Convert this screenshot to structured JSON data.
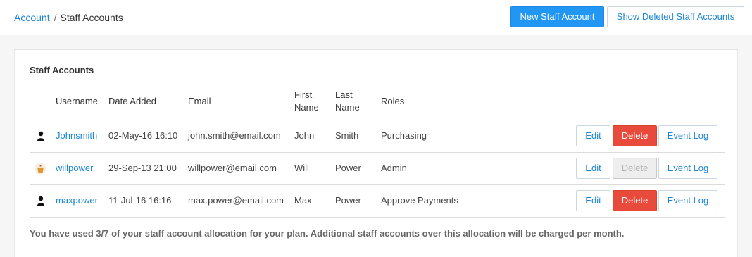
{
  "breadcrumb": {
    "parent": "Account",
    "separator": "/",
    "current": "Staff Accounts"
  },
  "header_actions": {
    "new_label": "New Staff Account",
    "show_deleted_label": "Show Deleted Staff Accounts"
  },
  "panel": {
    "title": "Staff Accounts",
    "columns": {
      "username": "Username",
      "date_added": "Date Added",
      "email": "Email",
      "first_name_1": "First",
      "first_name_2": "Name",
      "last_name_1": "Last",
      "last_name_2": "Name",
      "roles": "Roles"
    },
    "rows": [
      {
        "avatar": "person-silhouette-icon",
        "username": "Johnsmith",
        "date_added": "02-May-16 16:10",
        "email": "john.smith@email.com",
        "first_name": "John",
        "last_name": "Smith",
        "roles": "Purchasing",
        "edit_label": "Edit",
        "delete_label": "Delete",
        "delete_disabled": false,
        "log_label": "Event Log"
      },
      {
        "avatar": "cupcake-avatar-icon",
        "username": "willpower",
        "date_added": "29-Sep-13 21:00",
        "email": "willpower@email.com",
        "first_name": "Will",
        "last_name": "Power",
        "roles": "Admin",
        "edit_label": "Edit",
        "delete_label": "Delete",
        "delete_disabled": true,
        "log_label": "Event Log"
      },
      {
        "avatar": "person-silhouette-icon",
        "username": "maxpower",
        "date_added": "11-Jul-16 16:16",
        "email": "max.power@email.com",
        "first_name": "Max",
        "last_name": "Power",
        "roles": "Approve Payments",
        "edit_label": "Edit",
        "delete_label": "Delete",
        "delete_disabled": false,
        "log_label": "Event Log"
      }
    ],
    "footnote": "You have used 3/7 of your staff account allocation for your plan. Additional staff accounts over this allocation will be charged per month."
  },
  "colors": {
    "link": "#1b86d6",
    "primary": "#2196f3",
    "danger": "#e84b3c"
  }
}
